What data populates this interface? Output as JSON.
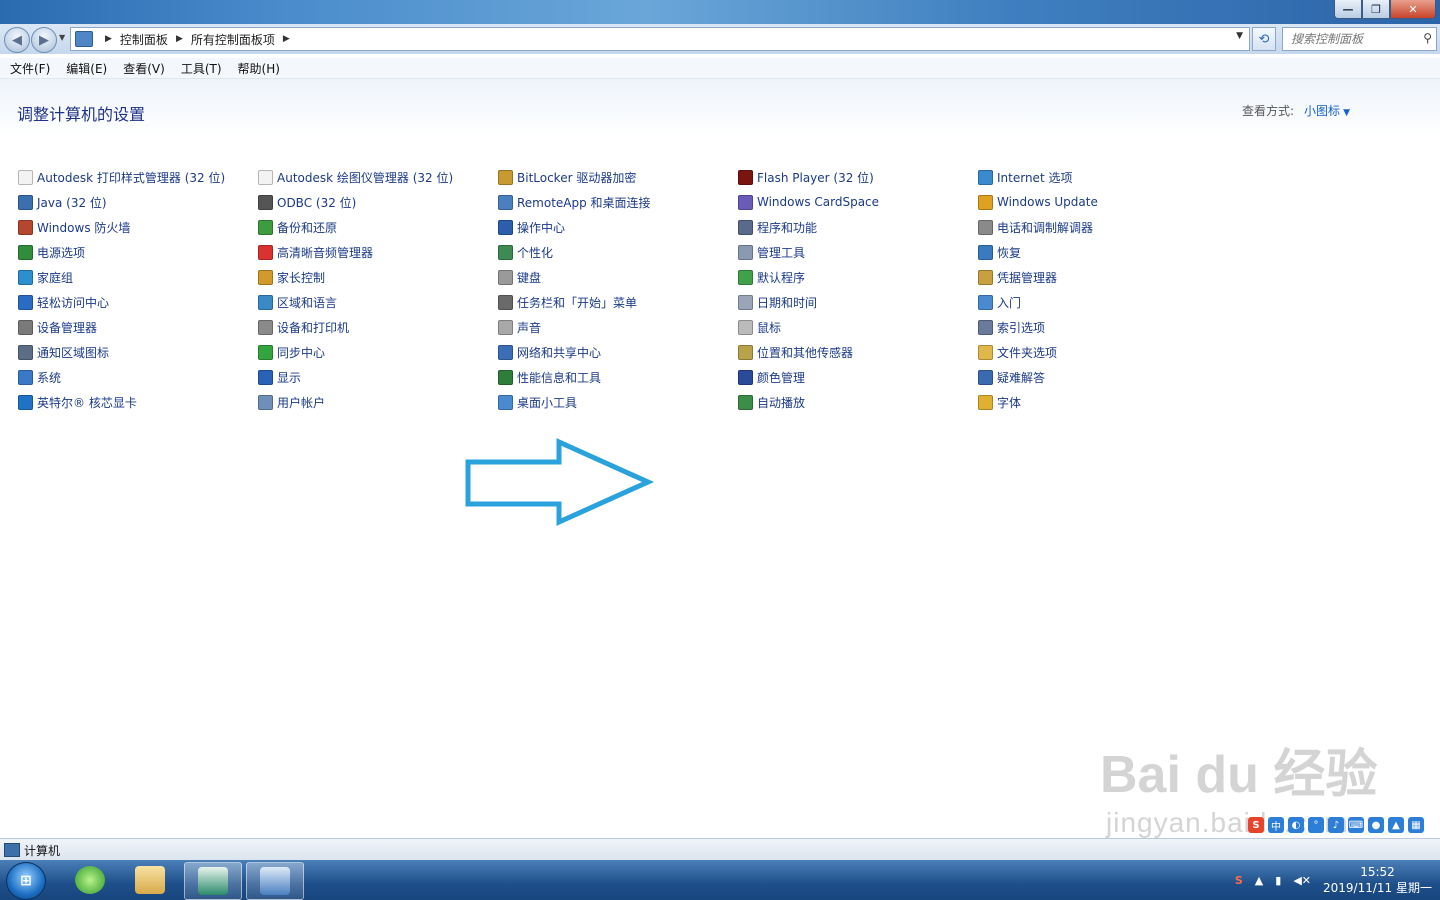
{
  "window": {
    "min_glyph": "—",
    "max_glyph": "❐",
    "close_glyph": "✕"
  },
  "address": {
    "crumbs": [
      "控制面板",
      "所有控制面板项"
    ],
    "search_placeholder": "搜索控制面板"
  },
  "menu": [
    "文件(F)",
    "编辑(E)",
    "查看(V)",
    "工具(T)",
    "帮助(H)"
  ],
  "header": {
    "title": "调整计算机的设置",
    "view_by_label": "查看方式:",
    "view_by_value": "小图标"
  },
  "items": [
    [
      {
        "label": "Autodesk 打印样式管理器 (32 位)",
        "icon": "document-icon",
        "color": "#f3f3f3"
      },
      {
        "label": "Java (32 位)",
        "icon": "java-icon",
        "color": "#3a6fb0"
      },
      {
        "label": "Windows 防火墙",
        "icon": "firewall-icon",
        "color": "#b4472d"
      },
      {
        "label": "电源选项",
        "icon": "power-options-icon",
        "color": "#2f8d3b"
      },
      {
        "label": "家庭组",
        "icon": "homegroup-icon",
        "color": "#2b8fd0"
      },
      {
        "label": "轻松访问中心",
        "icon": "ease-of-access-icon",
        "color": "#2a6cc4"
      },
      {
        "label": "设备管理器",
        "icon": "device-manager-icon",
        "color": "#7a7a7a"
      },
      {
        "label": "通知区域图标",
        "icon": "notification-area-icon",
        "color": "#5b6e86"
      },
      {
        "label": "系统",
        "icon": "system-icon",
        "color": "#3a78c8"
      },
      {
        "label": "英特尔® 核芯显卡",
        "icon": "intel-graphics-icon",
        "color": "#1f72c6"
      }
    ],
    [
      {
        "label": "Autodesk 绘图仪管理器 (32 位)",
        "icon": "document-icon",
        "color": "#f3f3f3"
      },
      {
        "label": "ODBC (32 位)",
        "icon": "odbc-icon",
        "color": "#555555"
      },
      {
        "label": "备份和还原",
        "icon": "backup-icon",
        "color": "#3d9b40"
      },
      {
        "label": "高清晰音频管理器",
        "icon": "audio-manager-icon",
        "color": "#d8332f"
      },
      {
        "label": "家长控制",
        "icon": "parental-controls-icon",
        "color": "#d29a2a"
      },
      {
        "label": "区域和语言",
        "icon": "region-language-icon",
        "color": "#3a8ac8"
      },
      {
        "label": "设备和打印机",
        "icon": "printer-icon",
        "color": "#8a8a8a"
      },
      {
        "label": "同步中心",
        "icon": "sync-center-icon",
        "color": "#34a43c"
      },
      {
        "label": "显示",
        "icon": "display-icon",
        "color": "#2a62b8"
      },
      {
        "label": "用户帐户",
        "icon": "user-accounts-icon",
        "color": "#6e8fb8"
      }
    ],
    [
      {
        "label": "BitLocker 驱动器加密",
        "icon": "bitlocker-icon",
        "color": "#c99a32"
      },
      {
        "label": "RemoteApp 和桌面连接",
        "icon": "remoteapp-icon",
        "color": "#4a7fc0"
      },
      {
        "label": "操作中心",
        "icon": "action-center-flag-icon",
        "color": "#2b5fae"
      },
      {
        "label": "个性化",
        "icon": "personalization-icon",
        "color": "#3d8a54"
      },
      {
        "label": "键盘",
        "icon": "keyboard-icon",
        "color": "#9a9a9a"
      },
      {
        "label": "任务栏和「开始」菜单",
        "icon": "taskbar-icon",
        "color": "#6a6a6a"
      },
      {
        "label": "声音",
        "icon": "speaker-icon",
        "color": "#a8a8a8"
      },
      {
        "label": "网络和共享中心",
        "icon": "network-icon",
        "color": "#3a6fb8"
      },
      {
        "label": "性能信息和工具",
        "icon": "performance-icon",
        "color": "#2e7d3a"
      },
      {
        "label": "桌面小工具",
        "icon": "gadgets-icon",
        "color": "#4a8ad0"
      }
    ],
    [
      {
        "label": "Flash Player (32 位)",
        "icon": "flash-icon",
        "color": "#7a1410"
      },
      {
        "label": "Windows CardSpace",
        "icon": "cardspace-icon",
        "color": "#6a5bb8"
      },
      {
        "label": "程序和功能",
        "icon": "programs-icon",
        "color": "#5a6a8a"
      },
      {
        "label": "管理工具",
        "icon": "admin-tools-icon",
        "color": "#8a9ab0"
      },
      {
        "label": "默认程序",
        "icon": "default-programs-icon",
        "color": "#3fa14a"
      },
      {
        "label": "日期和时间",
        "icon": "clock-icon",
        "color": "#9aa6b8"
      },
      {
        "label": "鼠标",
        "icon": "mouse-icon",
        "color": "#bbbbbb"
      },
      {
        "label": "位置和其他传感器",
        "icon": "sensors-icon",
        "color": "#b8a24a"
      },
      {
        "label": "颜色管理",
        "icon": "color-management-icon",
        "color": "#2a4a9a"
      },
      {
        "label": "自动播放",
        "icon": "autoplay-icon",
        "color": "#3c8c4a"
      }
    ],
    [
      {
        "label": "Internet 选项",
        "icon": "internet-options-icon",
        "color": "#3a8ad0"
      },
      {
        "label": "Windows Update",
        "icon": "windows-update-icon",
        "color": "#e0a020"
      },
      {
        "label": "电话和调制解调器",
        "icon": "modem-icon",
        "color": "#8a8a8a"
      },
      {
        "label": "恢复",
        "icon": "recovery-icon",
        "color": "#3a7ac0"
      },
      {
        "label": "凭据管理器",
        "icon": "credential-manager-icon",
        "color": "#c8a040"
      },
      {
        "label": "入门",
        "icon": "getting-started-icon",
        "color": "#4a8ad0"
      },
      {
        "label": "索引选项",
        "icon": "indexing-icon",
        "color": "#6a7a9a"
      },
      {
        "label": "文件夹选项",
        "icon": "folder-options-icon",
        "color": "#e0b84a"
      },
      {
        "label": "疑难解答",
        "icon": "troubleshooting-icon",
        "color": "#3a6ab0"
      },
      {
        "label": "字体",
        "icon": "fonts-icon",
        "color": "#e0b030"
      }
    ]
  ],
  "status": {
    "text": "计算机"
  },
  "watermark": {
    "main": "Bai du 经验",
    "sub": "jingyan.baidu.com"
  },
  "taskbar": {
    "clock_time": "15:52",
    "clock_date": "2019/11/11 星期一"
  },
  "colors": {
    "accent_arrow": "#2aa3dc",
    "link_text": "#1b3a87",
    "title_text": "#1e3287"
  }
}
